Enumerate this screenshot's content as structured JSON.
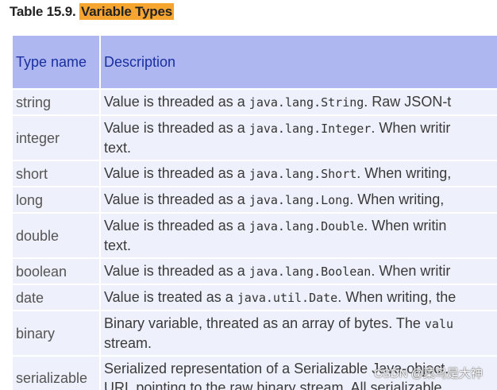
{
  "caption": {
    "prefix": "Table 15.9. ",
    "highlight": "Variable Types"
  },
  "table": {
    "headers": [
      "Type name",
      "Description"
    ],
    "rows": [
      {
        "name": "string",
        "pre": "Value is threaded as a ",
        "code": "java.lang.String",
        "post": ". Raw JSON-t",
        "line2": ""
      },
      {
        "name": "integer",
        "pre": "Value is threaded as a ",
        "code": "java.lang.Integer",
        "post": ". When writir",
        "line2": "text."
      },
      {
        "name": "short",
        "pre": "Value is threaded as a ",
        "code": "java.lang.Short",
        "post": ". When writing, ",
        "line2": ""
      },
      {
        "name": "long",
        "pre": "Value is threaded as a ",
        "code": "java.lang.Long",
        "post": ". When writing, ",
        "line2": ""
      },
      {
        "name": "double",
        "pre": "Value is threaded as a ",
        "code": "java.lang.Double",
        "post": ". When writin",
        "line2": "text."
      },
      {
        "name": "boolean",
        "pre": "Value is threaded as a ",
        "code": "java.lang.Boolean",
        "post": ". When writir",
        "line2": ""
      },
      {
        "name": "date",
        "pre": "Value is treated as a ",
        "code": "java.util.Date",
        "post": ". When writing, the",
        "line2": ""
      },
      {
        "name": "binary",
        "pre": "Binary variable, threated as an array of bytes. The ",
        "code": "valu",
        "post": "",
        "line2": "stream."
      },
      {
        "name": "serializable",
        "pre": "Serialized representation of a Serializable Java-object. ",
        "code": "",
        "post": "",
        "line2": "URL pointing to the raw binary stream. All serializable"
      }
    ]
  },
  "watermark": "CSDN @菜鸟是大神"
}
